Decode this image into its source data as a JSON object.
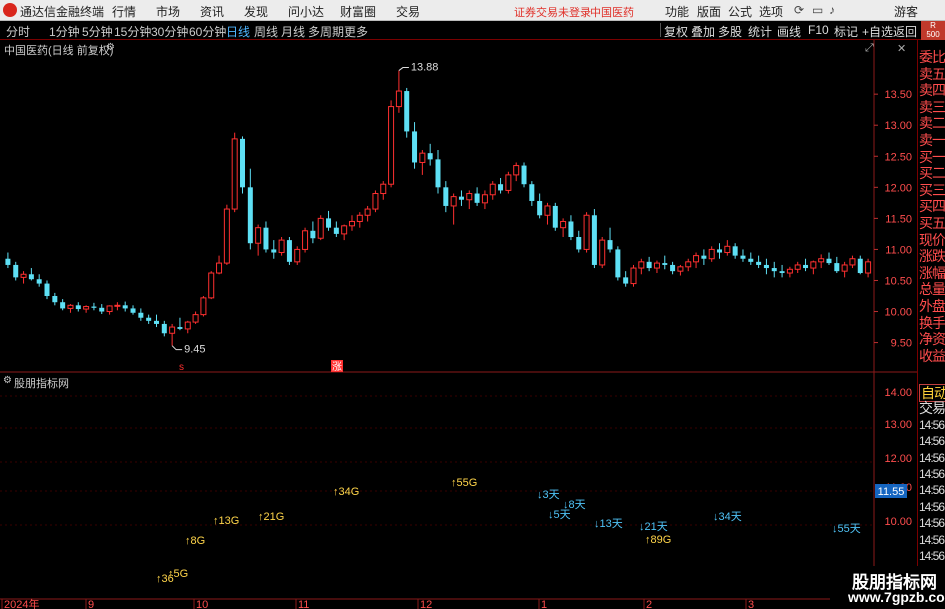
{
  "app": {
    "name": "通达信金融终端",
    "notice": "证券交易未登录",
    "stock": "中国医药"
  },
  "menu": [
    "行情",
    "市场",
    "资讯",
    "发现",
    "问小达",
    "财富圈",
    "交易"
  ],
  "menu_right": [
    "功能",
    "版面",
    "公式",
    "选项",
    "游客"
  ],
  "periods": [
    "分时",
    "1分钟",
    "5分钟",
    "15分钟",
    "30分钟",
    "60分钟",
    "日线",
    "周线",
    "月线",
    "多周期",
    "更多"
  ],
  "active_period": "日线",
  "tools": [
    "复权",
    "叠加",
    "多股",
    "统计",
    "画线",
    "F10",
    "标记",
    "+自选",
    "返回"
  ],
  "right_tag": {
    "line1": "R",
    "line2": "500"
  },
  "main_title": "中国医药(日线 前复权)",
  "indicator_title": "股朋指标网",
  "right_panel": [
    "委比",
    "卖五",
    "卖四",
    "卖三",
    "卖二",
    "卖一",
    "买一",
    "买二",
    "买三",
    "买四",
    "买五",
    "现价",
    "涨跌",
    "涨幅",
    "总量",
    "外盘",
    "换手",
    "净资",
    "收益"
  ],
  "right_panel_lower": [
    "自动",
    "交易",
    "14:56",
    "14:56",
    "14:56",
    "14:56",
    "14:56",
    "14:56",
    "14:56",
    "14:56",
    "14:56",
    "14:56",
    "14:56"
  ],
  "price_axis": [
    "13.50",
    "13.00",
    "12.50",
    "12.00",
    "11.50",
    "11.00",
    "10.50",
    "10.00",
    "9.50"
  ],
  "ind_axis": [
    "14.00",
    "13.00",
    "12.00",
    "11.00",
    "10.00"
  ],
  "ind_price_box": "11.55",
  "x_axis": [
    "2024年",
    "9",
    "10",
    "11",
    "12",
    "1",
    "2",
    "3"
  ],
  "price_high": "13.88",
  "price_low": "9.45",
  "markers": [
    "s",
    "涨"
  ],
  "signals": [
    {
      "text": "↑36",
      "x": 156,
      "y": 582,
      "color": "#ffd54a"
    },
    {
      "text": "↑5G",
      "x": 168,
      "y": 577,
      "color": "#ffd54a"
    },
    {
      "text": "↑8G",
      "x": 185,
      "y": 544,
      "color": "#ffd54a"
    },
    {
      "text": "↑13G",
      "x": 213,
      "y": 524,
      "color": "#ffd54a"
    },
    {
      "text": "↑21G",
      "x": 258,
      "y": 520,
      "color": "#ffd54a"
    },
    {
      "text": "↑34G",
      "x": 333,
      "y": 495,
      "color": "#ffd54a"
    },
    {
      "text": "↑55G",
      "x": 451,
      "y": 486,
      "color": "#ffd54a"
    },
    {
      "text": "↓3天",
      "x": 537,
      "y": 498,
      "color": "#4fc3f7"
    },
    {
      "text": "↓8天",
      "x": 563,
      "y": 508,
      "color": "#4fc3f7"
    },
    {
      "text": "↓5天",
      "x": 548,
      "y": 518,
      "color": "#4fc3f7"
    },
    {
      "text": "↓13天",
      "x": 594,
      "y": 527,
      "color": "#4fc3f7"
    },
    {
      "text": "↓21天",
      "x": 639,
      "y": 530,
      "color": "#4fc3f7"
    },
    {
      "text": "↑89G",
      "x": 645,
      "y": 543,
      "color": "#ffd54a"
    },
    {
      "text": "↓34天",
      "x": 713,
      "y": 520,
      "color": "#4fc3f7"
    },
    {
      "text": "↓55天",
      "x": 832,
      "y": 532,
      "color": "#4fc3f7"
    }
  ],
  "footer_logo": {
    "line1": "股朋指标网",
    "line2": "www.7gpzb.com"
  },
  "chart_data": {
    "type": "candlestick",
    "ylim": [
      9.3,
      14.05
    ],
    "candles": [
      [
        10.85,
        10.95,
        10.7,
        10.75
      ],
      [
        10.75,
        10.8,
        10.5,
        10.55
      ],
      [
        10.55,
        10.65,
        10.45,
        10.6
      ],
      [
        10.6,
        10.7,
        10.5,
        10.52
      ],
      [
        10.52,
        10.6,
        10.4,
        10.45
      ],
      [
        10.45,
        10.5,
        10.2,
        10.25
      ],
      [
        10.25,
        10.3,
        10.1,
        10.15
      ],
      [
        10.15,
        10.2,
        10.02,
        10.05
      ],
      [
        10.05,
        10.12,
        9.98,
        10.1
      ],
      [
        10.1,
        10.15,
        10.0,
        10.04
      ],
      [
        10.04,
        10.1,
        9.98,
        10.08
      ],
      [
        10.08,
        10.14,
        10.02,
        10.06
      ],
      [
        10.06,
        10.12,
        9.96,
        10.0
      ],
      [
        10.0,
        10.1,
        9.95,
        10.09
      ],
      [
        10.09,
        10.15,
        10.02,
        10.1
      ],
      [
        10.1,
        10.16,
        10.0,
        10.05
      ],
      [
        10.05,
        10.1,
        9.95,
        9.98
      ],
      [
        9.98,
        10.05,
        9.85,
        9.9
      ],
      [
        9.9,
        9.95,
        9.8,
        9.85
      ],
      [
        9.85,
        9.95,
        9.75,
        9.8
      ],
      [
        9.8,
        9.85,
        9.6,
        9.65
      ],
      [
        9.65,
        9.8,
        9.45,
        9.75
      ],
      [
        9.75,
        9.9,
        9.7,
        9.72
      ],
      [
        9.72,
        9.85,
        9.65,
        9.83
      ],
      [
        9.83,
        10.0,
        9.8,
        9.95
      ],
      [
        9.95,
        10.25,
        9.92,
        10.22
      ],
      [
        10.22,
        10.65,
        10.2,
        10.62
      ],
      [
        10.62,
        10.9,
        10.6,
        10.78
      ],
      [
        10.78,
        11.72,
        10.75,
        11.65
      ],
      [
        11.65,
        12.88,
        11.6,
        12.78
      ],
      [
        12.78,
        12.82,
        11.9,
        12.0
      ],
      [
        12.0,
        12.3,
        11.0,
        11.1
      ],
      [
        11.1,
        11.4,
        10.9,
        11.35
      ],
      [
        11.35,
        11.45,
        10.95,
        11.0
      ],
      [
        11.0,
        11.15,
        10.85,
        10.95
      ],
      [
        10.95,
        11.2,
        10.9,
        11.15
      ],
      [
        11.15,
        11.2,
        10.75,
        10.8
      ],
      [
        10.8,
        11.05,
        10.75,
        11.0
      ],
      [
        11.0,
        11.35,
        10.95,
        11.3
      ],
      [
        11.3,
        11.45,
        11.1,
        11.18
      ],
      [
        11.18,
        11.55,
        11.15,
        11.5
      ],
      [
        11.5,
        11.62,
        11.3,
        11.35
      ],
      [
        11.35,
        11.45,
        11.2,
        11.25
      ],
      [
        11.25,
        11.4,
        11.15,
        11.38
      ],
      [
        11.38,
        11.55,
        11.3,
        11.45
      ],
      [
        11.45,
        11.6,
        11.35,
        11.55
      ],
      [
        11.55,
        11.7,
        11.45,
        11.65
      ],
      [
        11.65,
        11.95,
        11.6,
        11.9
      ],
      [
        11.9,
        12.1,
        11.8,
        12.05
      ],
      [
        12.05,
        13.4,
        12.0,
        13.3
      ],
      [
        13.3,
        13.88,
        13.2,
        13.55
      ],
      [
        13.55,
        13.6,
        12.8,
        12.9
      ],
      [
        12.9,
        13.05,
        12.3,
        12.4
      ],
      [
        12.4,
        12.6,
        12.2,
        12.55
      ],
      [
        12.55,
        12.7,
        12.35,
        12.45
      ],
      [
        12.45,
        12.6,
        11.9,
        12.0
      ],
      [
        12.0,
        12.1,
        11.6,
        11.7
      ],
      [
        11.7,
        11.9,
        11.4,
        11.85
      ],
      [
        11.85,
        11.95,
        11.7,
        11.8
      ],
      [
        11.8,
        11.95,
        11.65,
        11.9
      ],
      [
        11.9,
        12.0,
        11.7,
        11.75
      ],
      [
        11.75,
        11.95,
        11.65,
        11.88
      ],
      [
        11.88,
        12.1,
        11.8,
        12.05
      ],
      [
        12.05,
        12.15,
        11.9,
        11.95
      ],
      [
        11.95,
        12.25,
        11.9,
        12.2
      ],
      [
        12.2,
        12.4,
        12.1,
        12.35
      ],
      [
        12.35,
        12.4,
        12.0,
        12.05
      ],
      [
        12.05,
        12.1,
        11.7,
        11.78
      ],
      [
        11.78,
        11.9,
        11.5,
        11.55
      ],
      [
        11.55,
        11.75,
        11.4,
        11.7
      ],
      [
        11.7,
        11.75,
        11.3,
        11.35
      ],
      [
        11.35,
        11.5,
        11.2,
        11.45
      ],
      [
        11.45,
        11.55,
        11.15,
        11.2
      ],
      [
        11.2,
        11.3,
        10.95,
        11.0
      ],
      [
        11.0,
        11.6,
        10.95,
        11.55
      ],
      [
        11.55,
        11.65,
        10.7,
        10.75
      ],
      [
        10.75,
        11.2,
        10.7,
        11.15
      ],
      [
        11.15,
        11.35,
        10.95,
        11.0
      ],
      [
        11.0,
        11.05,
        10.5,
        10.55
      ],
      [
        10.55,
        10.65,
        10.4,
        10.45
      ],
      [
        10.45,
        10.75,
        10.4,
        10.7
      ],
      [
        10.7,
        10.85,
        10.6,
        10.8
      ],
      [
        10.8,
        10.88,
        10.65,
        10.7
      ],
      [
        10.7,
        10.82,
        10.62,
        10.78
      ],
      [
        10.78,
        10.9,
        10.68,
        10.75
      ],
      [
        10.75,
        10.8,
        10.6,
        10.65
      ],
      [
        10.65,
        10.75,
        10.58,
        10.72
      ],
      [
        10.72,
        10.85,
        10.65,
        10.8
      ],
      [
        10.8,
        10.95,
        10.7,
        10.9
      ],
      [
        10.9,
        11.0,
        10.75,
        10.85
      ],
      [
        10.85,
        11.05,
        10.8,
        11.0
      ],
      [
        11.0,
        11.1,
        10.85,
        10.95
      ],
      [
        10.95,
        11.15,
        10.9,
        11.05
      ],
      [
        11.05,
        11.1,
        10.85,
        10.9
      ],
      [
        10.9,
        11.0,
        10.8,
        10.85
      ],
      [
        10.85,
        10.95,
        10.75,
        10.8
      ],
      [
        10.8,
        10.9,
        10.7,
        10.75
      ],
      [
        10.75,
        10.85,
        10.6,
        10.7
      ],
      [
        10.7,
        10.8,
        10.55,
        10.65
      ],
      [
        10.65,
        10.75,
        10.55,
        10.62
      ],
      [
        10.62,
        10.72,
        10.55,
        10.68
      ],
      [
        10.68,
        10.8,
        10.62,
        10.75
      ],
      [
        10.75,
        10.85,
        10.65,
        10.7
      ],
      [
        10.7,
        10.82,
        10.6,
        10.8
      ],
      [
        10.8,
        10.92,
        10.7,
        10.85
      ],
      [
        10.85,
        10.95,
        10.75,
        10.78
      ],
      [
        10.78,
        10.88,
        10.62,
        10.65
      ],
      [
        10.65,
        10.8,
        10.55,
        10.75
      ],
      [
        10.75,
        10.9,
        10.7,
        10.85
      ],
      [
        10.85,
        10.9,
        10.6,
        10.62
      ],
      [
        10.62,
        10.85,
        10.55,
        10.8
      ]
    ]
  }
}
